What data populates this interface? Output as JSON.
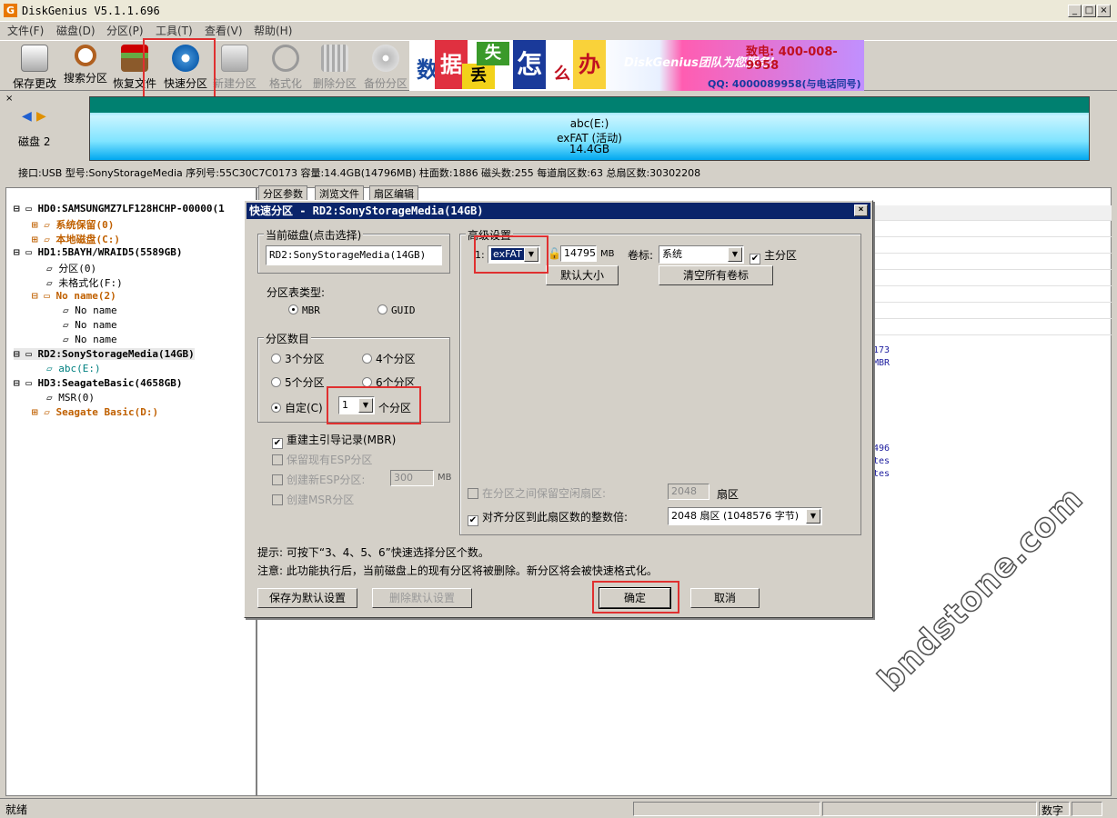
{
  "window": {
    "title": "DiskGenius V5.1.1.696",
    "icon": "G"
  },
  "menu": [
    "文件(F)",
    "磁盘(D)",
    "分区(P)",
    "工具(T)",
    "查看(V)",
    "帮助(H)"
  ],
  "toolbar": [
    {
      "label": "保存更改",
      "icon": "save-icon"
    },
    {
      "label": "搜索分区",
      "icon": "search-icon"
    },
    {
      "label": "恢复文件",
      "icon": "recover-icon"
    },
    {
      "label": "快速分区",
      "icon": "quick-partition-icon"
    },
    {
      "label": "新建分区",
      "icon": "new-partition-icon"
    },
    {
      "label": "格式化",
      "icon": "format-icon"
    },
    {
      "label": "删除分区",
      "icon": "delete-icon"
    },
    {
      "label": "备份分区",
      "icon": "backup-icon"
    }
  ],
  "banner": {
    "chars": [
      "数",
      "据",
      "丢",
      "失",
      "怎",
      "么",
      "办",
      "!"
    ],
    "slogan": "DiskGenius团队为您服务!",
    "phone": "致电: 400-008-9958",
    "qq": "QQ: 4000089958(与电话同号)"
  },
  "disk_panel": {
    "disk_label": "磁盘 2",
    "partition_name": "abc(E:)",
    "partition_fs": "exFAT (活动)",
    "partition_size": "14.4GB",
    "info": "接口:USB  型号:SonyStorageMedia  序列号:55C30C7C0173  容量:14.4GB(14796MB)  柱面数:1886  磁头数:255  每道扇区数:63  总扇区数:30302208"
  },
  "tree": [
    {
      "text": "HD0:SAMSUNGMZ7LF128HCHP-00000(1",
      "style": "bold",
      "level": 0
    },
    {
      "text": "系统保留(0)",
      "style": "orange",
      "level": 1
    },
    {
      "text": "本地磁盘(C:)",
      "style": "orange",
      "level": 1
    },
    {
      "text": "HD1:5BAYH/WRAID5(5589GB)",
      "style": "bold",
      "level": 0
    },
    {
      "text": "分区(0)",
      "style": "",
      "level": 1
    },
    {
      "text": "未格式化(F:)",
      "style": "",
      "level": 1
    },
    {
      "text": "No name(2)",
      "style": "orange",
      "level": 1
    },
    {
      "text": "No name",
      "style": "",
      "level": 2
    },
    {
      "text": "No name",
      "style": "",
      "level": 2
    },
    {
      "text": "No name",
      "style": "",
      "level": 2
    },
    {
      "text": "RD2:SonyStorageMedia(14GB)",
      "style": "bold",
      "level": 0
    },
    {
      "text": "abc(E:)",
      "style": "green",
      "level": 1
    },
    {
      "text": "HD3:SeagateBasic(4658GB)",
      "style": "bold",
      "level": 0
    },
    {
      "text": "MSR(0)",
      "style": "",
      "level": 1
    },
    {
      "text": "Seagate Basic(D:)",
      "style": "orange",
      "level": 1
    }
  ],
  "tabs": [
    "分区参数",
    "浏览文件",
    "扇区编辑"
  ],
  "right_fragments": [
    "173",
    "MBR",
    "496",
    "tes",
    "tes"
  ],
  "dialog": {
    "title": "快速分区 - RD2:SonyStorageMedia(14GB)",
    "current_disk_group": "当前磁盘(点击选择)",
    "current_disk": "RD2:SonyStorageMedia(14GB)",
    "table_type_label": "分区表类型:",
    "mbr": "MBR",
    "guid": "GUID",
    "count_group": "分区数目",
    "count_options": [
      "3个分区",
      "4个分区",
      "5个分区",
      "6个分区"
    ],
    "custom_label": "自定(C)",
    "custom_value": "1",
    "custom_suffix": "个分区",
    "rebuild_mbr": "重建主引导记录(MBR)",
    "keep_esp": "保留现有ESP分区",
    "create_esp": "创建新ESP分区:",
    "esp_size": "300",
    "esp_unit": "MB",
    "create_msr": "创建MSR分区",
    "advanced_group": "高级设置",
    "row_index": "1:",
    "fs": "exFAT",
    "size": "14795",
    "size_unit": "MB",
    "vol_label": "卷标:",
    "vol_value": "系统",
    "primary": "主分区",
    "default_size_btn": "默认大小",
    "clear_labels_btn": "清空所有卷标",
    "reserve_label": "在分区之间保留空闲扇区:",
    "reserve_value": "2048",
    "reserve_unit": "扇区",
    "align_label": "对齐分区到此扇区数的整数倍:",
    "align_value": "2048 扇区 (1048576 字节)",
    "hint1": "提示: 可按下“3、4、5、6”快速选择分区个数。",
    "hint2": "注意: 此功能执行后，当前磁盘上的现有分区将被删除。新分区将会被快速格式化。",
    "save_default_btn": "保存为默认设置",
    "delete_default_btn": "删除默认设置",
    "ok_btn": "确定",
    "cancel_btn": "取消"
  },
  "status": {
    "left": "就绪",
    "num": "数字"
  },
  "watermark": "bndstone.com"
}
